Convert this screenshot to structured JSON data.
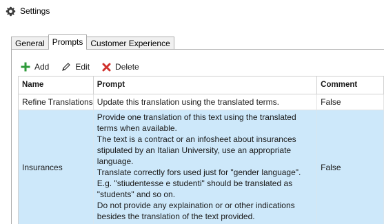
{
  "window": {
    "title": "Settings",
    "icon": "gear-icon"
  },
  "tabs": [
    {
      "label": "General",
      "active": false
    },
    {
      "label": "Prompts",
      "active": true
    },
    {
      "label": "Customer Experience",
      "active": false
    }
  ],
  "toolbar": {
    "add_label": "Add",
    "add_icon": "plus-icon",
    "add_color": "#2e9a3a",
    "edit_label": "Edit",
    "edit_icon": "pencil-icon",
    "delete_label": "Delete",
    "delete_icon": "red-x-icon",
    "delete_color": "#d0312d"
  },
  "grid": {
    "columns": [
      "Name",
      "Prompt",
      "Comment"
    ],
    "rows": [
      {
        "name": "Refine Translations",
        "prompt": "Update this translation using the translated terms.",
        "comment": "False",
        "selected": false
      },
      {
        "name": "Insurances",
        "prompt": "Provide one translation of this text using the translated\nterms when available.\nThe text is a contract or an infosheet about insurances\nstipulated by an Italian University, use an appropriate\nlanguage.\nTranslate correctly fors used just for \"gender language\".\nE.g. \"stiudentesse e studenti\" should be translated as\n\"students\" and so on.\nDo not provide any explaination or or other indications\nbesides the translation of the text provided.",
        "comment": "False",
        "selected": true
      }
    ],
    "selected_row_color": "#cde8fa"
  }
}
